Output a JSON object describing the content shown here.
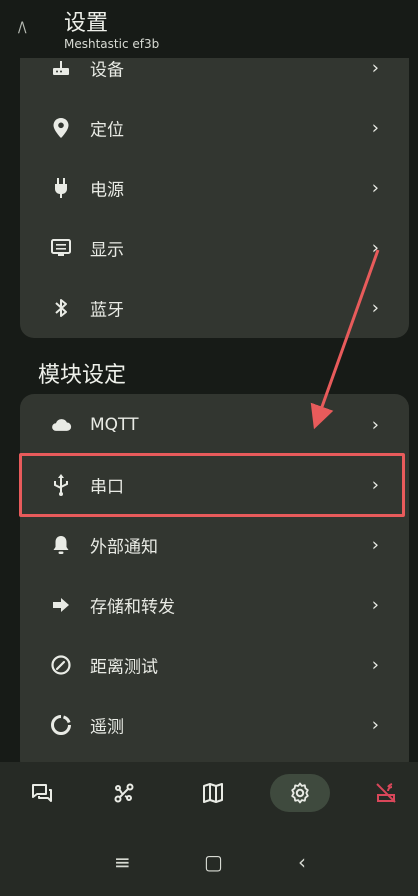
{
  "header": {
    "title": "设置",
    "subtitle": "Meshtastic ef3b",
    "logo": "/\\"
  },
  "radio_config": {
    "items": [
      {
        "label": "设备",
        "icon": "router-icon"
      },
      {
        "label": "定位",
        "icon": "location-icon"
      },
      {
        "label": "电源",
        "icon": "plug-icon"
      },
      {
        "label": "显示",
        "icon": "display-icon"
      },
      {
        "label": "蓝牙",
        "icon": "bluetooth-icon"
      }
    ]
  },
  "module_section": {
    "title": "模块设定",
    "items": [
      {
        "label": "MQTT",
        "icon": "cloud-icon"
      },
      {
        "label": "串口",
        "icon": "usb-icon"
      },
      {
        "label": "外部通知",
        "icon": "bell-icon"
      },
      {
        "label": "存储和转发",
        "icon": "forward-arrow-icon"
      },
      {
        "label": "距离测试",
        "icon": "gauge-icon"
      },
      {
        "label": "遥测",
        "icon": "telemetry-icon"
      }
    ]
  },
  "chevron": "›",
  "bottom_nav": [
    "messages-icon",
    "nodes-icon",
    "map-icon",
    "settings-icon",
    "disconnected-icon"
  ],
  "system_nav": {
    "recents": "≡",
    "home": "▢",
    "back": "‹"
  },
  "colors": {
    "background": "#171b17",
    "card": "#323630",
    "annotation": "#e85b5b",
    "active_nav": "#3f4a3e",
    "disconnected": "#d9475a"
  }
}
